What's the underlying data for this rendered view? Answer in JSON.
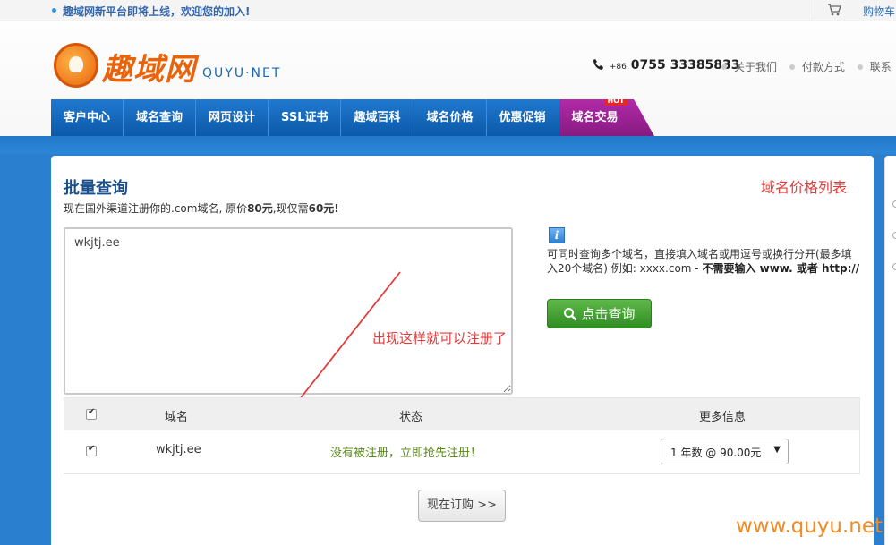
{
  "topbar": {
    "notice": "趣域网新平台即将上线，欢迎您的加入!",
    "cart_label": "购物车"
  },
  "logo": {
    "text": "趣域网",
    "sub": "QUYU·NET"
  },
  "header": {
    "phone_prefix": "+86",
    "phone": "0755 33385833",
    "links": [
      "关于我们",
      "付款方式",
      "联系"
    ]
  },
  "nav": {
    "items": [
      "客户中心",
      "域名查询",
      "网页设计",
      "SSL证书",
      "趣域百科",
      "域名价格",
      "优惠促销",
      "域名交易"
    ],
    "hot_badge": "HOT"
  },
  "main": {
    "title": "批量查询",
    "price_link": "域名价格列表",
    "promo_prefix": "现在国外渠道注册你的.com域名, 原价",
    "promo_old_price": "80元",
    "promo_mid": ",现仅需",
    "promo_new_price": "60元!",
    "query_value": "wkjtj.ee",
    "info_icon": "i",
    "info_text": "可同时查询多个域名，直接填入域名或用逗号或换行分开(最多填入20个域名) 例如: xxxx.com - ",
    "info_bold": "不需要输入 www. 或者 http://",
    "search_button": "点击查询",
    "annotation": "出现这样就可以注册了"
  },
  "results": {
    "headers": [
      "域名",
      "状态",
      "更多信息"
    ],
    "rows": [
      {
        "domain": "wkjtj.ee",
        "status": "没有被注册，立即抢先注册！",
        "option": "1 年数 @ 90.00元"
      }
    ]
  },
  "order_button": "现在订购 >>",
  "watermark": "www.quyu.net",
  "colors": {
    "nav_blue": "#0c58a8",
    "nav_hot": "#861a80",
    "accent_red": "#e33b3b",
    "search_green": "#2f8d21",
    "status_green": "#5a8a1a",
    "watermark_orange": "#f08c28"
  }
}
